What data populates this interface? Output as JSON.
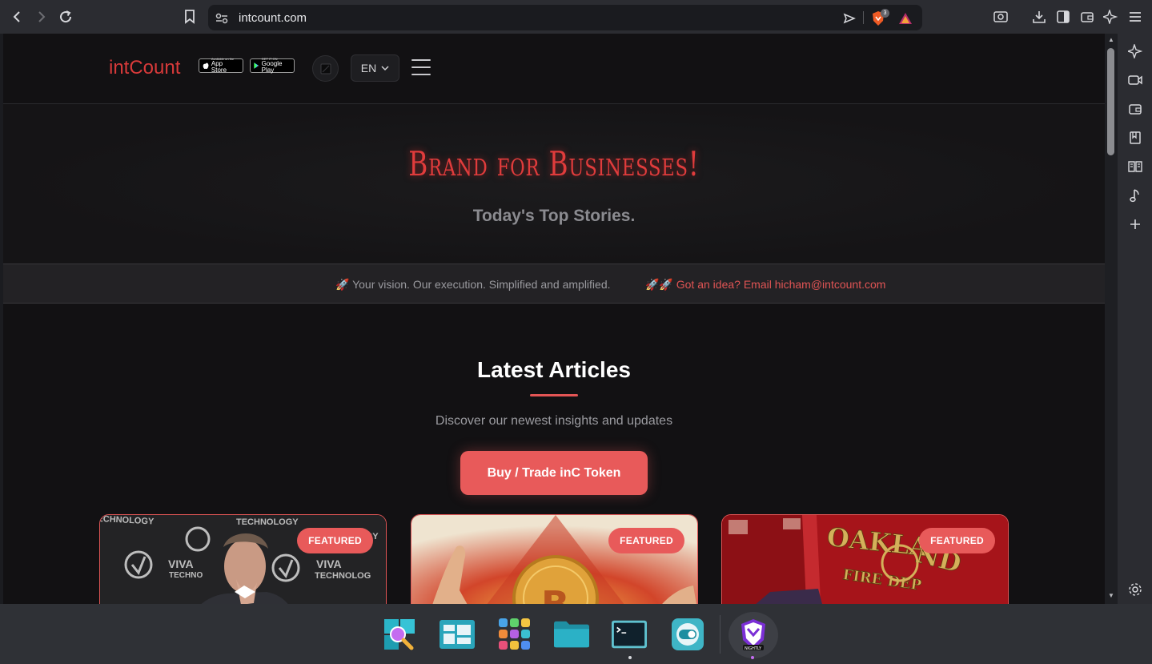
{
  "browser": {
    "url": "intcount.com",
    "shields_count": "3"
  },
  "site": {
    "brand": "intCount",
    "app_store": {
      "small": "Available on the",
      "big": "App Store"
    },
    "google_play": {
      "small": "GET IT ON",
      "big": "Google Play"
    },
    "language": "EN"
  },
  "hero": {
    "title": "Brand for Businesses!",
    "subtitle": "Today's Top Stories."
  },
  "ticker": {
    "item1": "🚀 Your vision. Our execution. Simplified and amplified.",
    "item2": "🚀🚀 Got an idea? Email hicham@intcount.com"
  },
  "articles": {
    "title": "Latest Articles",
    "description": "Discover our newest insights and updates",
    "cta": "Buy / Trade inC Token",
    "cards": [
      {
        "badge": "FEATURED",
        "image": "viva-technology-photo"
      },
      {
        "badge": "FEATURED",
        "image": "bitcoin-coin-illustration"
      },
      {
        "badge": "FEATURED",
        "image": "oakland-fire-department-photo"
      }
    ]
  },
  "colors": {
    "accent": "#e85a5a",
    "brand": "#d83a3a",
    "page_bg": "#121113"
  }
}
